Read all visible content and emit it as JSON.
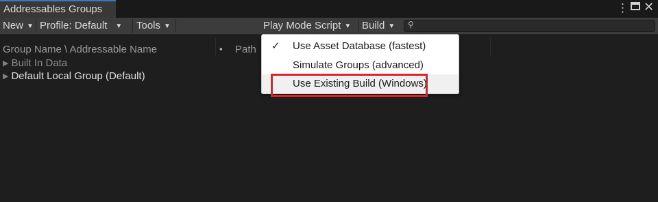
{
  "window": {
    "tab_title": "Addressables Groups",
    "kebab_icon": "⋮",
    "close_icon": "✕"
  },
  "toolbar": {
    "new_label": "New",
    "profile_label": "Profile: Default",
    "tools_label": "Tools",
    "play_mode_label": "Play Mode Script",
    "build_label": "Build",
    "search_placeholder": "",
    "dropdown_arrow": "▼",
    "search_icon": "⚲"
  },
  "columns": {
    "name": "Group Name \\ Addressable Name",
    "path": "Path",
    "path_icon": "▪"
  },
  "groups": [
    {
      "label": "Built In Data",
      "disabled": true
    },
    {
      "label": "Default Local Group (Default)",
      "disabled": false
    }
  ],
  "play_mode_menu": {
    "items": [
      {
        "label": "Use Asset Database (fastest)",
        "checked": true,
        "check_glyph": "✓"
      },
      {
        "label": "Simulate Groups (advanced)",
        "checked": false,
        "check_glyph": ""
      },
      {
        "label": "Use Existing Build (Windows)",
        "checked": false,
        "check_glyph": "",
        "highlighted": true
      }
    ]
  },
  "colors": {
    "accent_tab": "#3a79bb",
    "highlight_box": "#e0202a"
  }
}
